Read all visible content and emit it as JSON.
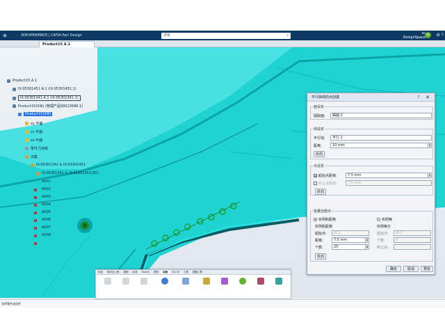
{
  "app": {
    "logo_glyph": "✳",
    "name": "3DEXPERIENCE | CATIA Part Design",
    "search_placeholder": "搜索",
    "user_line1": "sc",
    "user_line2": "DesignSpace",
    "add_glyph": "+",
    "right_glyph": "⚙ ?",
    "tab_label": "Product15 A.1"
  },
  "tree": {
    "items": [
      {
        "label": "Product15 A.1",
        "style": "plain"
      },
      {
        "label": "IX-05301451 A.1 (IX-05301451.1)",
        "style": "plain"
      },
      {
        "label": "IX-05301341 A.1 (IX-05301341.1)",
        "style": "boxed"
      },
      {
        "label": "Product15(SW) (物理产品00023998.1)",
        "style": "plain"
      },
      {
        "label": "Product15(SW)",
        "style": "hl"
      },
      {
        "label": "xy 平面",
        "style": "plain"
      },
      {
        "label": "yz 平面",
        "style": "plain"
      },
      {
        "label": "zx 平面",
        "style": "plain"
      },
      {
        "label": "零件几何体",
        "style": "plain"
      },
      {
        "label": "点集",
        "style": "plain"
      },
      {
        "label": "IX-05301341 & IX-05301451",
        "style": "plain"
      },
      {
        "label": "IX-05301341 & IX-05301451(3D)",
        "style": "plain"
      },
      {
        "label": "A001",
        "style": "plain"
      },
      {
        "label": "A002",
        "style": "plain"
      },
      {
        "label": "A003",
        "style": "plain"
      },
      {
        "label": "A004",
        "style": "plain"
      },
      {
        "label": "A005",
        "style": "plain"
      },
      {
        "label": "A006",
        "style": "plain"
      },
      {
        "label": "A007",
        "style": "plain"
      },
      {
        "label": "A008",
        "style": "plain"
      }
    ]
  },
  "dialog": {
    "title": "平行曲线的点创建",
    "help": "?",
    "close": "✕",
    "surface_group": {
      "legend": "面设定",
      "label": "提取面:",
      "value": "曲面.2"
    },
    "line_group": {
      "legend": "线设定",
      "curve_label": "平行线:",
      "curve_value": "平行.1",
      "dist_label": "距离:",
      "dist_value": "10 mm",
      "reverse": "反向"
    },
    "point_group": {
      "legend": "点设定",
      "start_label": "起始点距离:",
      "start_value": "7.5 mm",
      "end_label": "终止点距离:",
      "end_value": "7.5 mm",
      "reverse": "反向"
    },
    "batch_group": {
      "legend": "批量创建点",
      "opt_instance": "实例和距离",
      "opt_equal": "实例等",
      "left_legend": "实例和距离",
      "left_start_label": "起始点:",
      "left_start_value": "点.2",
      "left_dist_label": "距离:",
      "left_dist_value": "7.5 mm",
      "left_count_label": "个数:",
      "left_count_value": "25",
      "right_legend": "实例等分",
      "right_start_label": "起始点:",
      "right_start_value": "点.2",
      "right_count_label": "个数:",
      "right_count_value": "0",
      "right_end_label": "终止点:",
      "right_end_value": "-",
      "reverse": "反向"
    },
    "ok": "确定",
    "cancel": "取消",
    "preview": "预览"
  },
  "ribbon": {
    "tabs": [
      "标准",
      "操作及工具",
      "视图",
      "区域",
      "Sketch",
      "图形",
      "曲面",
      "3D-3S",
      "工具",
      "视图工具"
    ]
  },
  "status": {
    "text": "选择零件或组件"
  },
  "colors": {
    "model": "#19d0d0",
    "model_dark": "#0aa3a6",
    "titlebar": "#0c3a63",
    "accent": "#1f6fe5"
  }
}
